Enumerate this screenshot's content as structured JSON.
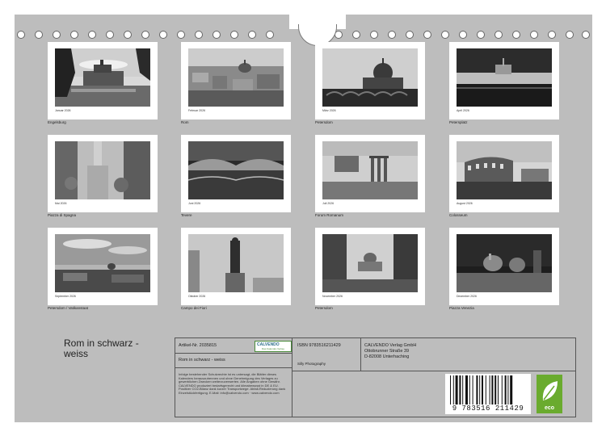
{
  "months": [
    {
      "month": "Januar 2026",
      "caption": "Engelsburg"
    },
    {
      "month": "Februar 2026",
      "caption": "Rom"
    },
    {
      "month": "März 2026",
      "caption": "Petersdom"
    },
    {
      "month": "April 2026",
      "caption": "Petersplatz"
    },
    {
      "month": "Mai 2026",
      "caption": "Piazza di Spagna"
    },
    {
      "month": "Juni 2026",
      "caption": "Tevere"
    },
    {
      "month": "Juli 2026",
      "caption": "Forum Romanum"
    },
    {
      "month": "August 2026",
      "caption": "Colosseum"
    },
    {
      "month": "September 2026",
      "caption": "Petersdom / Vatikanstaat"
    },
    {
      "month": "Oktober 2026",
      "caption": "Campo dei Fiori"
    },
    {
      "month": "November 2026",
      "caption": "Petersdom"
    },
    {
      "month": "Dezember 2026",
      "caption": "Piazza Venezia"
    }
  ],
  "title": "Rom in schwarz - weiss",
  "info": {
    "article": "Artikel-Nr. 2035815",
    "logo": "CALVENDO",
    "logo_sub": "Das Kalender-Verlag",
    "calendar_title": "Rom in schwarz - weiss",
    "disclaimer": "Infolge bestehender Schutzrechte ist es untersagt, die Blätter dieses Kalenders herauszutrennen und ohne Genehmigung des Verlages zu gewerblichen Zwecken weiterzuverwerten. Alle Angaben ohne Gewähr. CALVENDO produziert bedarfsgerecht und klimabewusst in DE & EU. Positiver CO2-Bilanz dank kurzer Transportwege. Abfall-Reduzierung dank Einzelstückfertigung. E-Mail: info@calvendo.com · www.calvendo.com",
    "isbn": "ISBN 9783516211429",
    "author": "Silly Photography",
    "publisher": "CALVENDO Verlag GmbH",
    "street": "Ottobrunner Straße 39",
    "city": "D-82008 Unterhaching",
    "barcode_digits": "9 783516 211429",
    "eco_label": "eco"
  }
}
